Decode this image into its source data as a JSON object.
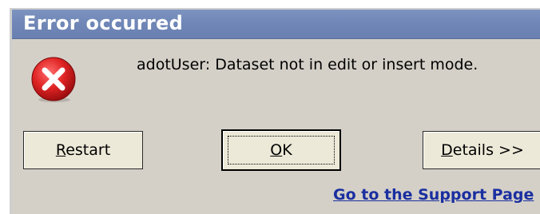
{
  "dialog": {
    "title": "Error occurred",
    "icon": "error-x-icon",
    "message": "adotUser: Dataset not in edit or insert mode.",
    "buttons": {
      "restart": {
        "mnemonic": "R",
        "rest": "estart"
      },
      "ok": {
        "mnemonic": "O",
        "rest": "K"
      },
      "details": {
        "mnemonic": "D",
        "rest": "etails >>"
      }
    },
    "support_link": "Go to the Support Page"
  },
  "colors": {
    "titlebar": "#7086b7",
    "dialog_bg": "#d4d0c8",
    "link": "#1a2fa0",
    "error_red": "#d0191d"
  }
}
